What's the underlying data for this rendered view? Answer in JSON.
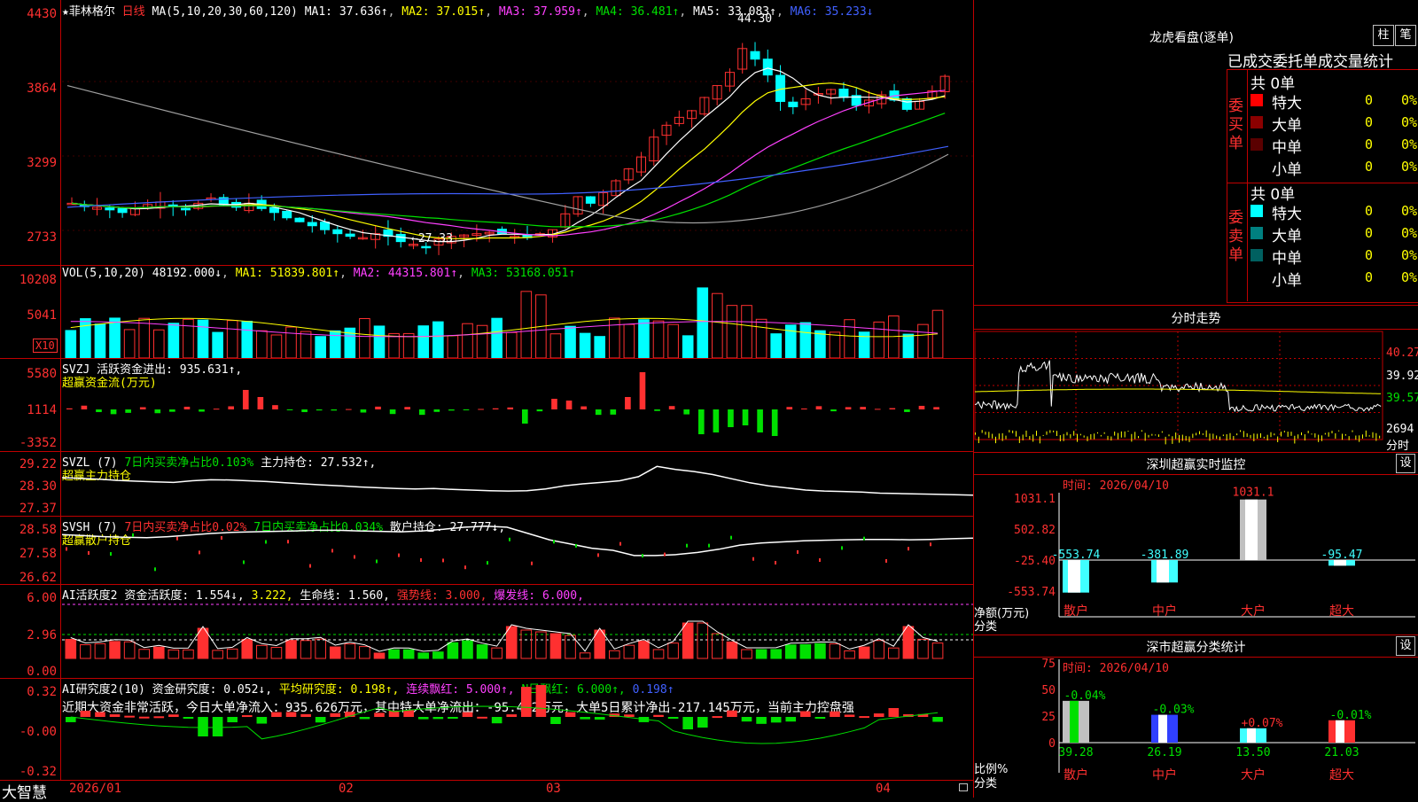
{
  "main_chart": {
    "header": {
      "title": "★菲林格尔",
      "period": "日线",
      "ma_params": "MA(5,10,20,30,60,120)",
      "ma1": "MA1: 37.636↑",
      "ma2": "MA2: 37.015↑",
      "ma3": "MA3: 37.959↑",
      "ma4": "MA4: 36.481↑",
      "ma5": "MA5: 33.083↑",
      "ma6": "MA6: 35.233↓"
    },
    "y_labels": [
      "4430",
      "3864",
      "3299",
      "2733"
    ],
    "high_marker": "44.30",
    "low_marker": "←27.33"
  },
  "vol_panel": {
    "header": "VOL(5,10,20)",
    "value": "48192.000↓",
    "ma1": "MA1: 51839.801↑",
    "ma2": "MA2: 44315.801↑",
    "ma3": "MA3: 53168.051↑",
    "y_labels": [
      "10208",
      "5041"
    ],
    "unit": "X10"
  },
  "svzj_panel": {
    "header": "SVZJ",
    "label": "活跃资金进出: 935.631↑,",
    "sublabel": "超赢资金流(万元)",
    "y_labels": [
      "5580",
      "1114",
      "-3352"
    ]
  },
  "svzl_panel": {
    "header": "SVZL (7)",
    "ratio": "7日内买卖净占比0.103%",
    "label": "主力持仓: 27.532↑,",
    "sublabel": "超赢主力持仓",
    "y_labels": [
      "29.22",
      "28.30",
      "27.37"
    ]
  },
  "svsh_panel": {
    "header": "SVSH (7)",
    "ratio1": "7日内买卖净占比0.02%",
    "ratio2": "7日内买卖净占比0.034%",
    "label": "散户持仓: 27.777↓,",
    "sublabel": "超赢散户持仓",
    "y_labels": [
      "28.58",
      "27.58",
      "26.62"
    ]
  },
  "ai_active_panel": {
    "header": "AI活跃度2",
    "label": "资金活跃度: 1.554↓,",
    "v2": "3.222,",
    "life": "生命线: 1.560,",
    "strong": "强势线: 3.000,",
    "burst": "爆发线: 6.000,",
    "y_labels": [
      "6.00",
      "2.96",
      "0.00"
    ]
  },
  "ai_research_panel": {
    "header": "AI研究度2(10)",
    "label": "资金研究度: 0.052↓,",
    "avg": "平均研究度: 0.198↑,",
    "streak": "连续飘红: 5.000↑,",
    "nday": "N日飘红: 6.000↑,",
    "v5": "0.198↑",
    "summary": "近期大资金非常活跃，今日大单净流入：935.626万元，其中特大单净流出：-95.472万元，大单5日累计净出-217.145万元，当前主力控盘强",
    "y_labels": [
      "0.32",
      "-0.00",
      "-0.32"
    ]
  },
  "x_axis": {
    "logo": "大智慧",
    "dates": [
      "2026/01",
      "02",
      "03",
      "04"
    ]
  },
  "right_panel": {
    "dragon_title": "龙虎看盘(逐单)",
    "btn_bar": "柱",
    "btn_pen": "笔",
    "tabs_line": "已成交委托单成交量统计",
    "buy_side_label": "委买单",
    "sell_side_label": "委卖单",
    "buy_total": "共 0单",
    "sell_total": "共 0单",
    "rows": [
      "特大",
      "大单",
      "中单",
      "小单"
    ],
    "row_count": "0",
    "row_pct": "0%",
    "timeline_title": "分时走势",
    "timeline_prices": [
      "40.27",
      "39.92",
      "39.57"
    ],
    "timeline_vol": "2694",
    "timeline_unit": "分时",
    "monitor_title": "深圳超赢实时监控",
    "monitor_btn": "设",
    "monitor_time": "时间: 2026/04/10",
    "monitor_y": [
      "1031.1",
      "502.82",
      "-25.40",
      "-553.74"
    ],
    "monitor_axis_label1": "净额(万元)",
    "monitor_axis_label2": "分类",
    "monitor_cats": [
      "散户",
      "中户",
      "大户",
      "超大"
    ],
    "monitor_values": [
      "-553.74",
      "-381.89",
      "1031.1",
      "-95.47"
    ],
    "stats_title": "深市超赢分类统计",
    "stats_btn": "设",
    "stats_time": "时间: 2026/04/10",
    "stats_y": [
      "75",
      "50",
      "25",
      "0"
    ],
    "stats_axis_label1": "比例%",
    "stats_axis_label2": "分类",
    "stats_cats": [
      "散户",
      "中户",
      "大户",
      "超大"
    ],
    "stats_pcts": [
      "-0.04%",
      "-0.03%",
      "+0.07%",
      "-0.01%"
    ],
    "stats_values": [
      "39.28",
      "26.19",
      "13.50",
      "21.03"
    ]
  },
  "colors": {
    "up": "#ff3030",
    "down": "#00ffff",
    "grid": "#c00000",
    "ma1": "#ffffff",
    "ma2": "#ffff00",
    "ma3": "#ff40ff",
    "ma4": "#00e000",
    "ma5": "#a0a0a0",
    "ma6": "#4060ff"
  }
}
